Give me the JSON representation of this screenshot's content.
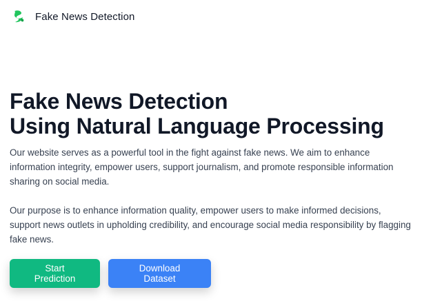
{
  "navbar": {
    "brand_name": "Fake News Detection",
    "logo_icon": "leaf-s-logo-icon",
    "logo_color": "#22c55e"
  },
  "hero": {
    "title_line1": "Fake News Detection",
    "title_line2": "Using Natural Language Processing",
    "paragraph1": "Our website serves as a powerful tool in the fight against fake news. We aim to enhance information integrity, empower users, support journalism, and promote responsible information sharing on social media.",
    "paragraph2": "Our purpose is to enhance information quality, empower users to make informed decisions, support news outlets in upholding credibility, and encourage social media responsibility by flagging fake news."
  },
  "actions": {
    "start_prediction_label": "Start Prediction",
    "start_prediction_color": "#10b981",
    "download_dataset_label": "Download Dataset",
    "download_dataset_color": "#3b82f6"
  }
}
